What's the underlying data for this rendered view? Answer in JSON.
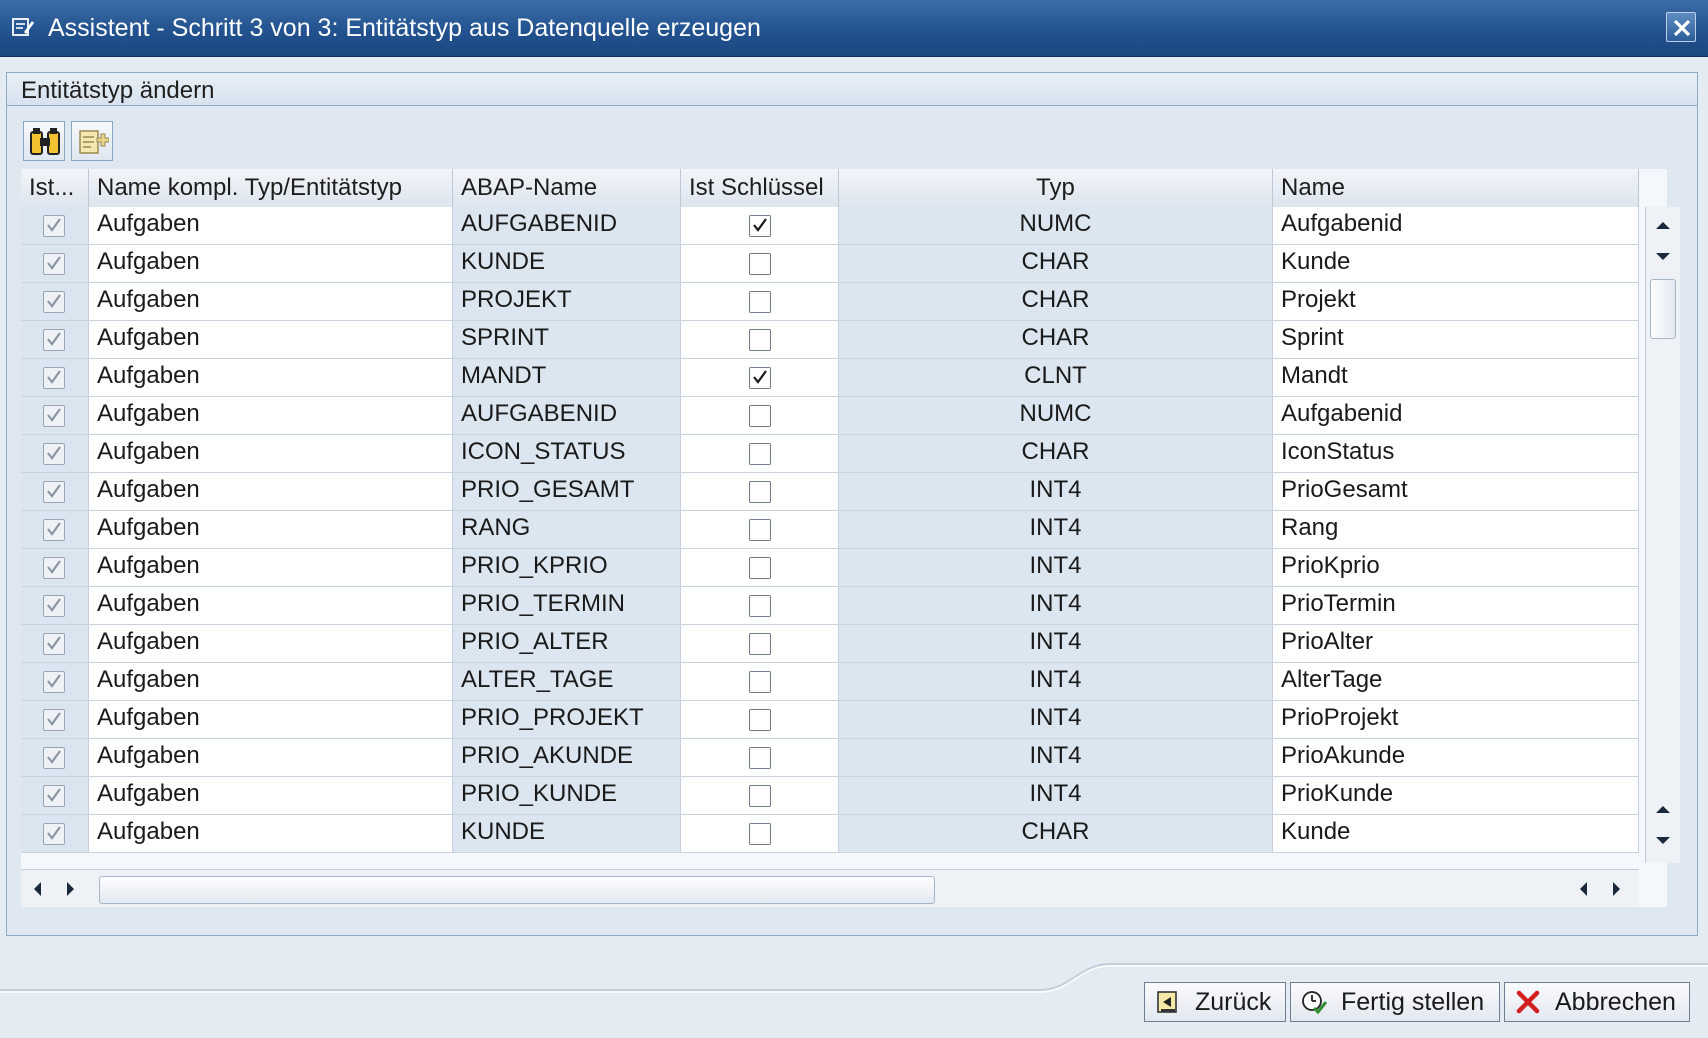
{
  "window": {
    "title": "Assistent - Schritt 3 von 3: Entitätstyp aus Datenquelle erzeugen",
    "close_label": "Close"
  },
  "group": {
    "title": "Entitätstyp ändern"
  },
  "toolbar": {
    "icons": [
      "find-icon",
      "add-field-icon"
    ]
  },
  "table": {
    "columns": [
      "Ist...",
      "Name kompl. Typ/Entitätstyp",
      "ABAP-Name",
      "Ist Schlüssel",
      "Typ",
      "Name"
    ],
    "rows": [
      {
        "ist": true,
        "entity": "Aufgaben",
        "abap": "AUFGABENID",
        "key": true,
        "typ": "NUMC",
        "name": "Aufgabenid"
      },
      {
        "ist": true,
        "entity": "Aufgaben",
        "abap": "KUNDE",
        "key": false,
        "typ": "CHAR",
        "name": "Kunde"
      },
      {
        "ist": true,
        "entity": "Aufgaben",
        "abap": "PROJEKT",
        "key": false,
        "typ": "CHAR",
        "name": "Projekt"
      },
      {
        "ist": true,
        "entity": "Aufgaben",
        "abap": "SPRINT",
        "key": false,
        "typ": "CHAR",
        "name": "Sprint"
      },
      {
        "ist": true,
        "entity": "Aufgaben",
        "abap": "MANDT",
        "key": true,
        "typ": "CLNT",
        "name": "Mandt"
      },
      {
        "ist": true,
        "entity": "Aufgaben",
        "abap": "AUFGABENID",
        "key": false,
        "typ": "NUMC",
        "name": "Aufgabenid"
      },
      {
        "ist": true,
        "entity": "Aufgaben",
        "abap": "ICON_STATUS",
        "key": false,
        "typ": "CHAR",
        "name": "IconStatus"
      },
      {
        "ist": true,
        "entity": "Aufgaben",
        "abap": "PRIO_GESAMT",
        "key": false,
        "typ": "INT4",
        "name": "PrioGesamt"
      },
      {
        "ist": true,
        "entity": "Aufgaben",
        "abap": "RANG",
        "key": false,
        "typ": "INT4",
        "name": "Rang"
      },
      {
        "ist": true,
        "entity": "Aufgaben",
        "abap": "PRIO_KPRIO",
        "key": false,
        "typ": "INT4",
        "name": "PrioKprio"
      },
      {
        "ist": true,
        "entity": "Aufgaben",
        "abap": "PRIO_TERMIN",
        "key": false,
        "typ": "INT4",
        "name": "PrioTermin"
      },
      {
        "ist": true,
        "entity": "Aufgaben",
        "abap": "PRIO_ALTER",
        "key": false,
        "typ": "INT4",
        "name": "PrioAlter"
      },
      {
        "ist": true,
        "entity": "Aufgaben",
        "abap": "ALTER_TAGE",
        "key": false,
        "typ": "INT4",
        "name": "AlterTage"
      },
      {
        "ist": true,
        "entity": "Aufgaben",
        "abap": "PRIO_PROJEKT",
        "key": false,
        "typ": "INT4",
        "name": "PrioProjekt"
      },
      {
        "ist": true,
        "entity": "Aufgaben",
        "abap": "PRIO_AKUNDE",
        "key": false,
        "typ": "INT4",
        "name": "PrioAkunde"
      },
      {
        "ist": true,
        "entity": "Aufgaben",
        "abap": "PRIO_KUNDE",
        "key": false,
        "typ": "INT4",
        "name": "PrioKunde"
      },
      {
        "ist": true,
        "entity": "Aufgaben",
        "abap": "KUNDE",
        "key": false,
        "typ": "CHAR",
        "name": "Kunde"
      }
    ]
  },
  "footer": {
    "back_label": "Zurück",
    "finish_label": "Fertig stellen",
    "cancel_label": "Abbrechen"
  },
  "colors": {
    "title_bar": "#22528f",
    "cancel_icon": "#d21f1f",
    "finish_icon": "#2e8b2e"
  }
}
